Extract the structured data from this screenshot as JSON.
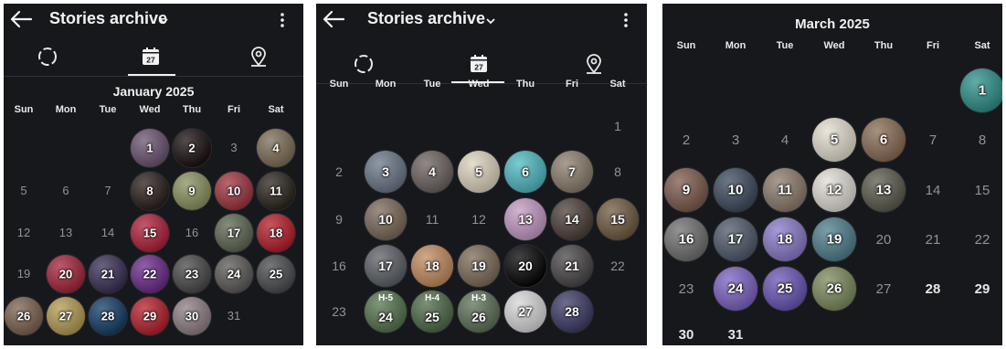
{
  "panels": [
    {
      "title": "Stories archive",
      "month": "January 2025",
      "weekdays": [
        "Sun",
        "Mon",
        "Tue",
        "Wed",
        "Thu",
        "Fri",
        "Sat"
      ],
      "rows": [
        [
          null,
          null,
          null,
          {
            "d": "1",
            "story": true,
            "color": "#6a5470"
          },
          {
            "d": "2",
            "story": true,
            "color": "#1b1010"
          },
          {
            "d": "3",
            "story": false
          },
          {
            "d": "4",
            "story": true,
            "color": "#7d6e57"
          }
        ],
        [
          {
            "d": "5",
            "story": false
          },
          {
            "d": "6",
            "story": false
          },
          {
            "d": "7",
            "story": false
          },
          {
            "d": "8",
            "story": true,
            "color": "#2a1f1a"
          },
          {
            "d": "9",
            "story": true,
            "color": "#8a9160"
          },
          {
            "d": "10",
            "story": true,
            "color": "#a0343f"
          },
          {
            "d": "11",
            "story": true,
            "color": "#2b241d"
          }
        ],
        [
          {
            "d": "12",
            "story": false
          },
          {
            "d": "13",
            "story": false
          },
          {
            "d": "14",
            "story": false
          },
          {
            "d": "15",
            "story": true,
            "color": "#b0203a"
          },
          {
            "d": "16",
            "story": false
          },
          {
            "d": "17",
            "story": true,
            "color": "#5e6752"
          },
          {
            "d": "18",
            "story": true,
            "color": "#b51d2a"
          }
        ],
        [
          {
            "d": "19",
            "story": false
          },
          {
            "d": "20",
            "story": true,
            "color": "#a3243a"
          },
          {
            "d": "21",
            "story": true,
            "color": "#3a2f55"
          },
          {
            "d": "22",
            "story": true,
            "color": "#6b2a8a"
          },
          {
            "d": "23",
            "story": true,
            "color": "#494949"
          },
          {
            "d": "24",
            "story": true,
            "color": "#5c5a57"
          },
          {
            "d": "25",
            "story": true,
            "color": "#4a4b4e"
          }
        ],
        [
          {
            "d": "26",
            "story": true,
            "color": "#7c6250"
          },
          {
            "d": "27",
            "story": true,
            "color": "#b39a52"
          },
          {
            "d": "28",
            "story": true,
            "color": "#143c66"
          },
          {
            "d": "29",
            "story": true,
            "color": "#b41f2b"
          },
          {
            "d": "30",
            "story": true,
            "color": "#8d7e84"
          },
          {
            "d": "31",
            "story": false
          },
          null
        ]
      ]
    },
    {
      "title": "Stories archive",
      "month": "",
      "weekdays": [
        "Sun",
        "Mon",
        "Tue",
        "Wed",
        "Thu",
        "Fri",
        "Sat"
      ],
      "rows": [
        [
          null,
          null,
          null,
          null,
          null,
          null,
          {
            "d": "1",
            "story": false
          }
        ],
        [
          {
            "d": "2",
            "story": false
          },
          {
            "d": "3",
            "story": true,
            "color": "#6b7688"
          },
          {
            "d": "4",
            "story": true,
            "color": "#6c625e"
          },
          {
            "d": "5",
            "story": true,
            "color": "#ddd3bf"
          },
          {
            "d": "6",
            "story": true,
            "color": "#4fb9c2"
          },
          {
            "d": "7",
            "story": true,
            "color": "#8b7d6c"
          },
          {
            "d": "8",
            "story": false
          }
        ],
        [
          {
            "d": "9",
            "story": false
          },
          {
            "d": "10",
            "story": true,
            "color": "#7a6858"
          },
          {
            "d": "11",
            "story": false
          },
          {
            "d": "12",
            "story": false
          },
          {
            "d": "13",
            "story": true,
            "color": "#c39ac3"
          },
          {
            "d": "14",
            "story": true,
            "color": "#4d3f38"
          },
          {
            "d": "15",
            "story": true,
            "color": "#6f5a40"
          }
        ],
        [
          {
            "d": "16",
            "story": false
          },
          {
            "d": "17",
            "story": true,
            "color": "#5c6066"
          },
          {
            "d": "18",
            "story": true,
            "color": "#c28c5e"
          },
          {
            "d": "19",
            "story": true,
            "color": "#7b6c58"
          },
          {
            "d": "20",
            "story": true,
            "color": "#050505"
          },
          {
            "d": "21",
            "story": true,
            "color": "#4a4648"
          },
          {
            "d": "22",
            "story": false
          }
        ],
        [
          {
            "d": "23",
            "story": false
          },
          {
            "d": "24",
            "story": true,
            "color": "#56734f",
            "tag": "H-5"
          },
          {
            "d": "25",
            "story": true,
            "color": "#4f6a4a",
            "tag": "H-4"
          },
          {
            "d": "26",
            "story": true,
            "color": "#5f7058",
            "tag": "H-3"
          },
          {
            "d": "27",
            "story": true,
            "color": "#d8d8d8"
          },
          {
            "d": "28",
            "story": true,
            "color": "#3d3c66"
          },
          null
        ]
      ]
    },
    {
      "title": "",
      "month": "March 2025",
      "weekdays": [
        "Sun",
        "Mon",
        "Tue",
        "Wed",
        "Thu",
        "Fri",
        "Sat"
      ],
      "rows": [
        [
          null,
          null,
          null,
          null,
          null,
          null,
          {
            "d": "1",
            "story": true,
            "color": "#2e8f8a"
          }
        ],
        [
          {
            "d": "2",
            "story": false
          },
          {
            "d": "3",
            "story": false
          },
          {
            "d": "4",
            "story": false
          },
          {
            "d": "5",
            "story": true,
            "color": "#e4ddcf"
          },
          {
            "d": "6",
            "story": true,
            "color": "#8a6b52"
          },
          {
            "d": "7",
            "story": false
          },
          {
            "d": "8",
            "story": false
          }
        ],
        [
          {
            "d": "9",
            "story": true,
            "color": "#7c5a4c"
          },
          {
            "d": "10",
            "story": true,
            "color": "#3e4a5e"
          },
          {
            "d": "11",
            "story": true,
            "color": "#8c7a6a"
          },
          {
            "d": "12",
            "story": true,
            "color": "#e1dcd5"
          },
          {
            "d": "13",
            "story": true,
            "color": "#5a5a4e"
          },
          {
            "d": "14",
            "story": false
          },
          {
            "d": "15",
            "story": false
          }
        ],
        [
          {
            "d": "16",
            "story": true,
            "color": "#707070"
          },
          {
            "d": "17",
            "story": true,
            "color": "#4e5a6a"
          },
          {
            "d": "18",
            "story": true,
            "color": "#8a7ac8"
          },
          {
            "d": "19",
            "story": true,
            "color": "#4e7f8c"
          },
          {
            "d": "20",
            "story": false
          },
          {
            "d": "21",
            "story": false
          },
          {
            "d": "22",
            "story": false
          }
        ],
        [
          {
            "d": "23",
            "story": false
          },
          {
            "d": "24",
            "story": true,
            "color": "#7b62c2"
          },
          {
            "d": "25",
            "story": true,
            "color": "#6a55b5"
          },
          {
            "d": "26",
            "story": true,
            "color": "#7c8a5e"
          },
          {
            "d": "27",
            "story": false
          },
          {
            "d": "28",
            "story": false,
            "bright": true
          },
          {
            "d": "29",
            "story": false,
            "bright": true
          }
        ],
        [
          {
            "d": "30",
            "story": false,
            "bright": true
          },
          {
            "d": "31",
            "story": false,
            "bright": true
          },
          null,
          null,
          null,
          null,
          null
        ]
      ]
    }
  ],
  "icons": {
    "back": "back-arrow-icon",
    "dropdown": "chevron-down-icon",
    "menu": "more-vertical-icon",
    "tab_highlights": "dashed-circle-icon",
    "tab_calendar": "calendar-icon",
    "tab_map": "map-pin-icon"
  },
  "calendar_icon_label": "27"
}
